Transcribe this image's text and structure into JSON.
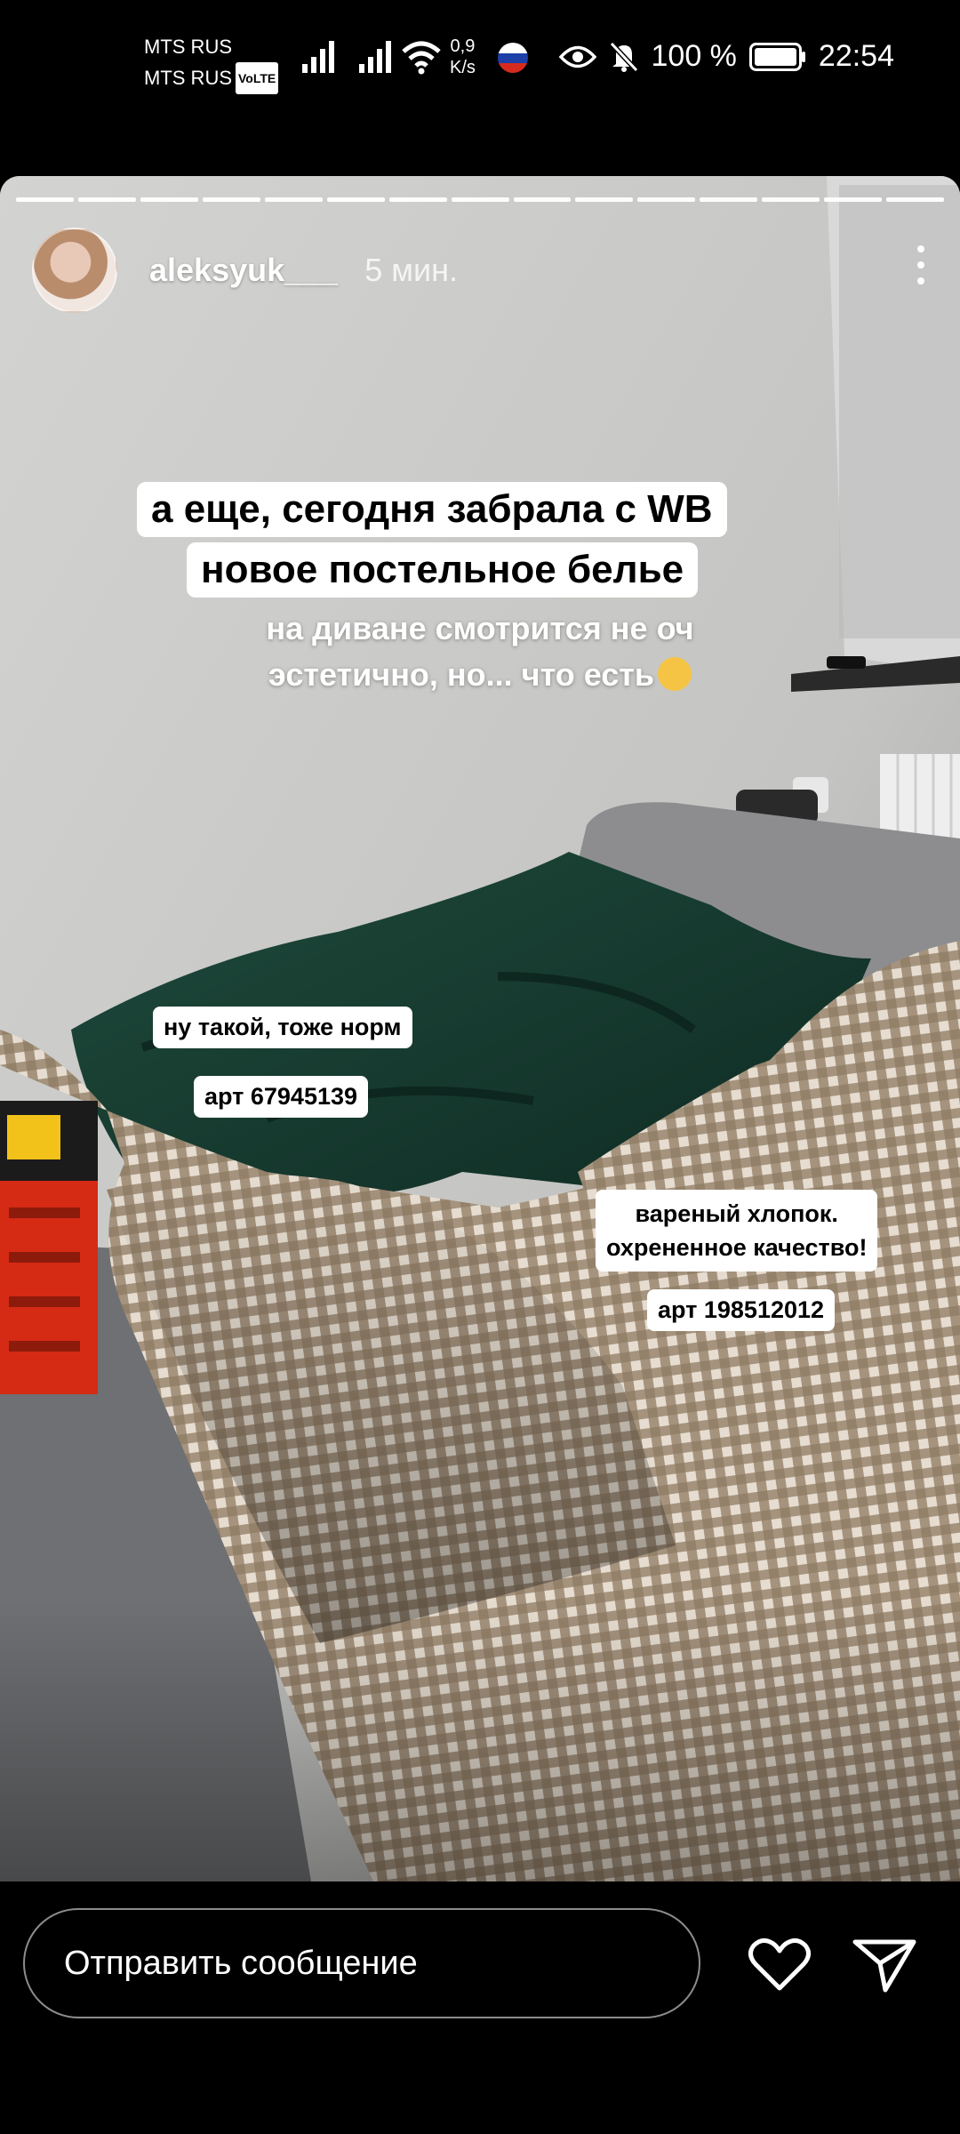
{
  "status_bar": {
    "carrier_1": "MTS RUS",
    "carrier_2": "MTS RUS",
    "volte_badge": "VoLTE",
    "net_speed_value": "0,9",
    "net_speed_unit": "K/s",
    "battery_percent": "100 %",
    "clock": "22:54",
    "icons": [
      "signal-icon",
      "signal-icon",
      "wifi-icon",
      "russia-flag-icon",
      "eye-icon",
      "bell-muted-icon",
      "battery-icon"
    ]
  },
  "story": {
    "segments_total": 15,
    "segments_completed": 15,
    "username": "aleksyuk___",
    "posted_ago": "5 мин.",
    "headline_line_1": "а еще, сегодня забрала с WB",
    "headline_line_2": "новое постельное белье",
    "caption_line_1": "на диване смотрится не оч",
    "caption_line_2": "эстетично, но... что есть",
    "tag_green_note": "ну такой, тоже норм",
    "tag_green_art": "арт 67945139",
    "tag_check_note_1": "вареный хлопок.",
    "tag_check_note_2": "охрененное качество!",
    "tag_check_art": "арт 198512012"
  },
  "footer": {
    "message_placeholder": "Отправить сообщение",
    "icons": [
      "heart-icon",
      "send-icon"
    ]
  },
  "colors": {
    "background": "#000000",
    "text_primary": "#ffffff",
    "sticker_bg": "#ffffff",
    "sticker_text": "#000000"
  }
}
